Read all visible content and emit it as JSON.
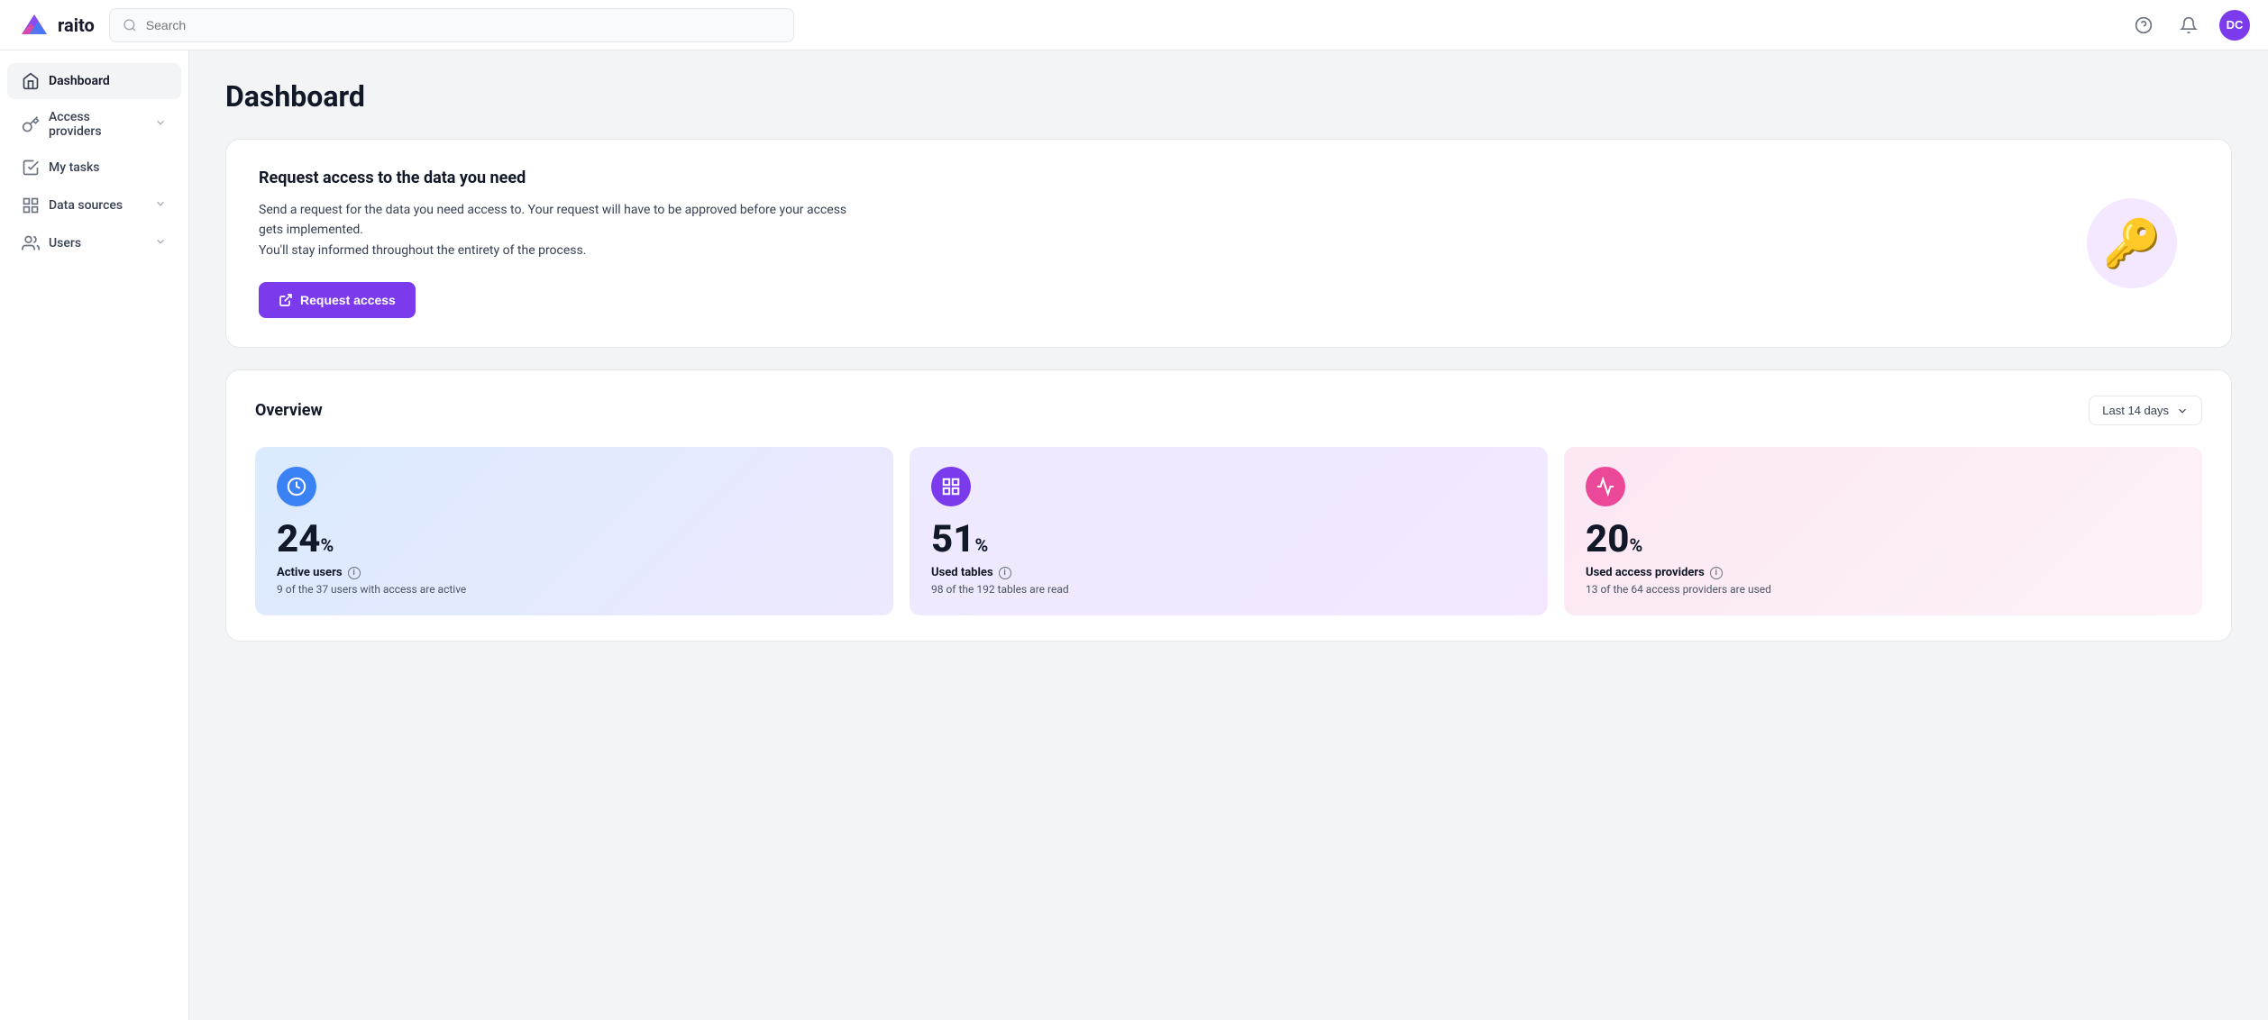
{
  "app": {
    "name": "raito"
  },
  "topnav": {
    "search_placeholder": "Search",
    "avatar_initials": "DC"
  },
  "sidebar": {
    "items": [
      {
        "id": "dashboard",
        "label": "Dashboard",
        "active": true,
        "has_chevron": false
      },
      {
        "id": "access-providers",
        "label": "Access providers",
        "active": false,
        "has_chevron": true
      },
      {
        "id": "my-tasks",
        "label": "My tasks",
        "active": false,
        "has_chevron": false
      },
      {
        "id": "data-sources",
        "label": "Data sources",
        "active": false,
        "has_chevron": true
      },
      {
        "id": "users",
        "label": "Users",
        "active": false,
        "has_chevron": true
      }
    ]
  },
  "page": {
    "title": "Dashboard"
  },
  "request_card": {
    "heading": "Request access to the data you need",
    "body_line1": "Send a request for the data you need access to. Your request will have to be approved before your access gets implemented.",
    "body_line2": "You'll stay informed throughout the entirety of the process.",
    "button_label": "Request access"
  },
  "overview": {
    "title": "Overview",
    "period_label": "Last 14 days",
    "stats": [
      {
        "id": "active-users",
        "value": "24",
        "percent_sign": "%",
        "label": "Active users",
        "sub": "9 of the 37 users with access are active",
        "color": "blue"
      },
      {
        "id": "used-tables",
        "value": "51",
        "percent_sign": "%",
        "label": "Used tables",
        "sub": "98 of the 192 tables are read",
        "color": "purple"
      },
      {
        "id": "used-access-providers",
        "value": "20",
        "percent_sign": "%",
        "label": "Used access providers",
        "sub": "13 of the 64 access providers are used",
        "color": "pink"
      }
    ]
  }
}
